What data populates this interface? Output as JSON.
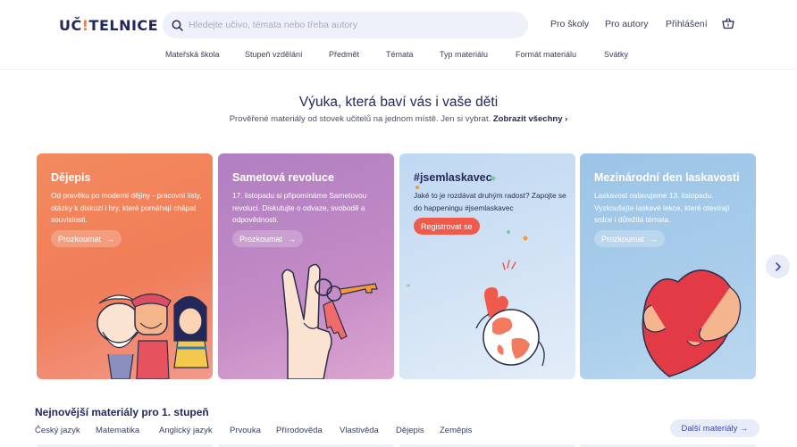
{
  "header": {
    "logo_text_1": "UČ",
    "logo_text_2": "!",
    "logo_text_3": "TELNICE",
    "search_placeholder": "Hledejte učivo, témata nebo třeba autory",
    "links": [
      "Pro školy",
      "Pro autory",
      "Přihlášení"
    ],
    "cart_icon": "basket-icon"
  },
  "category_nav": [
    "Mateřská škola",
    "Stupeň vzdělání",
    "Předmět",
    "Témata",
    "Typ materiálu",
    "Formát materiálu",
    "Svátky"
  ],
  "hero": {
    "title": "Výuka, která baví vás i vaše děti",
    "subtitle": "Prověřené materiály od stovek učitelů na jednom místě. Jen si vybrat.",
    "link": "Zobrazit všechny"
  },
  "cards": [
    {
      "title": "Dějepis",
      "desc": "Od pravěku po moderní dějiny - pracovní listy, otázky k diskuzi i hry, které pomáhají chápat souvislosti.",
      "button": "Prozkoumat",
      "bg": "#f07d58"
    },
    {
      "title": "Sametová revoluce",
      "desc": "17. listopadu si připomínáme Sametovou revoluci. Diskutujte o odvaze, svobodě a odpovědnosti.",
      "button": "Prozkoumat",
      "bg": "#c48bc6"
    },
    {
      "title": "#jsemlaskavec",
      "desc": "Jaké to je rozdávat druhým radost? Zapojte se do happeningu #jsemlaskavec",
      "button": "Registrovat se",
      "bg": "#d4e4f5",
      "button_color": "#ef5a4a"
    },
    {
      "title": "Mezinárodní den laskavosti",
      "desc": "Laskavost oslavujeme 13. listopadu. Vyzkoušejte laskavé lekce, které otevírají srdce i důležitá témata.",
      "button": "Prozkoumat",
      "bg": "#a9cdeb"
    }
  ],
  "carousel_next_icon": "chevron-right-icon",
  "latest": {
    "title": "Nejnovější materiály pro 1. stupeň",
    "subjects": [
      "Český jazyk",
      "Matematika",
      "Anglický jazyk",
      "Prvouka",
      "Přírodověda",
      "Vlastivěda",
      "Dějepis",
      "Zeměpis"
    ],
    "more_button": "Další materiály",
    "more_icon": "arrow-right-icon"
  },
  "colors": {
    "brand_navy": "#23285a",
    "accent_orange": "#f07a4d",
    "accent_red": "#ef5a4a",
    "link_blue": "#3b4bb0"
  }
}
